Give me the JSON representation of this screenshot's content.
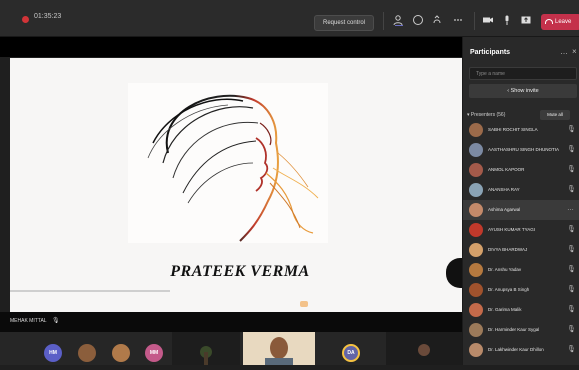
{
  "topbar": {
    "timer": "01:35:23",
    "request_control": "Request control",
    "leave": "Leave",
    "icons": [
      "participants-icon",
      "chat-icon",
      "reactions-icon",
      "more-icon",
      "camera-icon",
      "mic-icon",
      "share-icon"
    ]
  },
  "stage": {
    "slide_title": "PRATEEK VERMA",
    "presenter": "MEHAK MITTAL"
  },
  "gallery": {
    "avatars": [
      {
        "label": "HM",
        "color": "#5b5fc7"
      },
      {
        "label": "",
        "color": "#8b5e3c"
      },
      {
        "label": "",
        "color": "#b07a4a"
      },
      {
        "label": "MM",
        "color": "#c45a8a"
      },
      {
        "label": "DA",
        "color": "#6264a7"
      }
    ]
  },
  "participants": {
    "title": "Participants",
    "search_placeholder": "Type a name",
    "show_invite": "Show invite",
    "section": "Presenters (56)",
    "mute_all": "Mute all",
    "people": [
      {
        "name": "SABHI ROCHIT SINGLA",
        "color": "#9b6a4a"
      },
      {
        "name": "AASTHASHRU SINGH DHUNOTIA",
        "color": "#7c8aa3"
      },
      {
        "name": "ANMOL KAPOOR",
        "color": "#a45a4a"
      },
      {
        "name": "ANANSHA RAY",
        "color": "#8aa3b5"
      },
      {
        "name": "Ashima Agarwal",
        "color": "#c48a6a"
      },
      {
        "name": "AYUSH KUMAR TYAGI",
        "color": "#c0392b"
      },
      {
        "name": "DIVYA BHARDWAJ",
        "color": "#d4a06a"
      },
      {
        "name": "Dr. Anshu Yadav",
        "color": "#b5793f"
      },
      {
        "name": "Dr. Anupsya B Singh",
        "color": "#a0522d"
      },
      {
        "name": "Dr. Garima Malik",
        "color": "#c46a4a"
      },
      {
        "name": "Dr. Harminder Kaur Sygal",
        "color": "#9c7a5a"
      },
      {
        "name": "Dr. Lakhwinder Kaur Dhillon",
        "color": "#b88a6a"
      }
    ]
  }
}
